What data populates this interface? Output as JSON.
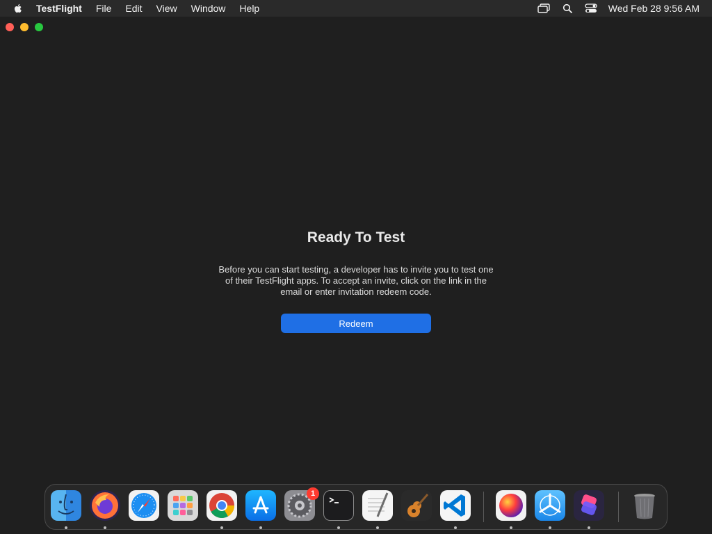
{
  "menubar": {
    "app_name": "TestFlight",
    "menus": [
      "File",
      "Edit",
      "View",
      "Window",
      "Help"
    ],
    "clock": "Wed Feb 28  9:56 AM"
  },
  "main": {
    "title": "Ready To Test",
    "description": "Before you can start testing, a developer has to invite you to test one of their TestFlight apps. To accept an invite, click on the link in the email or enter invitation redeem code.",
    "redeem_label": "Redeem"
  },
  "dock": {
    "items": [
      {
        "name": "finder",
        "icon": "finder-icon"
      },
      {
        "name": "firefox",
        "icon": "firefox-icon"
      },
      {
        "name": "safari",
        "icon": "safari-icon"
      },
      {
        "name": "launchpad",
        "icon": "launchpad-icon"
      },
      {
        "name": "chrome",
        "icon": "chrome-icon"
      },
      {
        "name": "app-store",
        "icon": "app-store-icon"
      },
      {
        "name": "system-settings",
        "icon": "gear-icon",
        "badge": "1"
      },
      {
        "name": "terminal",
        "icon": "terminal-icon"
      },
      {
        "name": "textedit",
        "icon": "textedit-icon"
      },
      {
        "name": "garageband",
        "icon": "guitar-icon"
      },
      {
        "name": "vscode",
        "icon": "vscode-icon"
      },
      {
        "name": "color-app",
        "icon": "color-sphere-icon"
      },
      {
        "name": "testflight",
        "icon": "testflight-icon"
      },
      {
        "name": "shortcuts",
        "icon": "shortcuts-icon"
      },
      {
        "name": "trash",
        "icon": "trash-icon"
      }
    ]
  },
  "colors": {
    "accent": "#1f6fe5",
    "close": "#ff5f57",
    "minimize": "#febc2e",
    "zoom": "#28c840",
    "badge": "#ff3b30"
  }
}
